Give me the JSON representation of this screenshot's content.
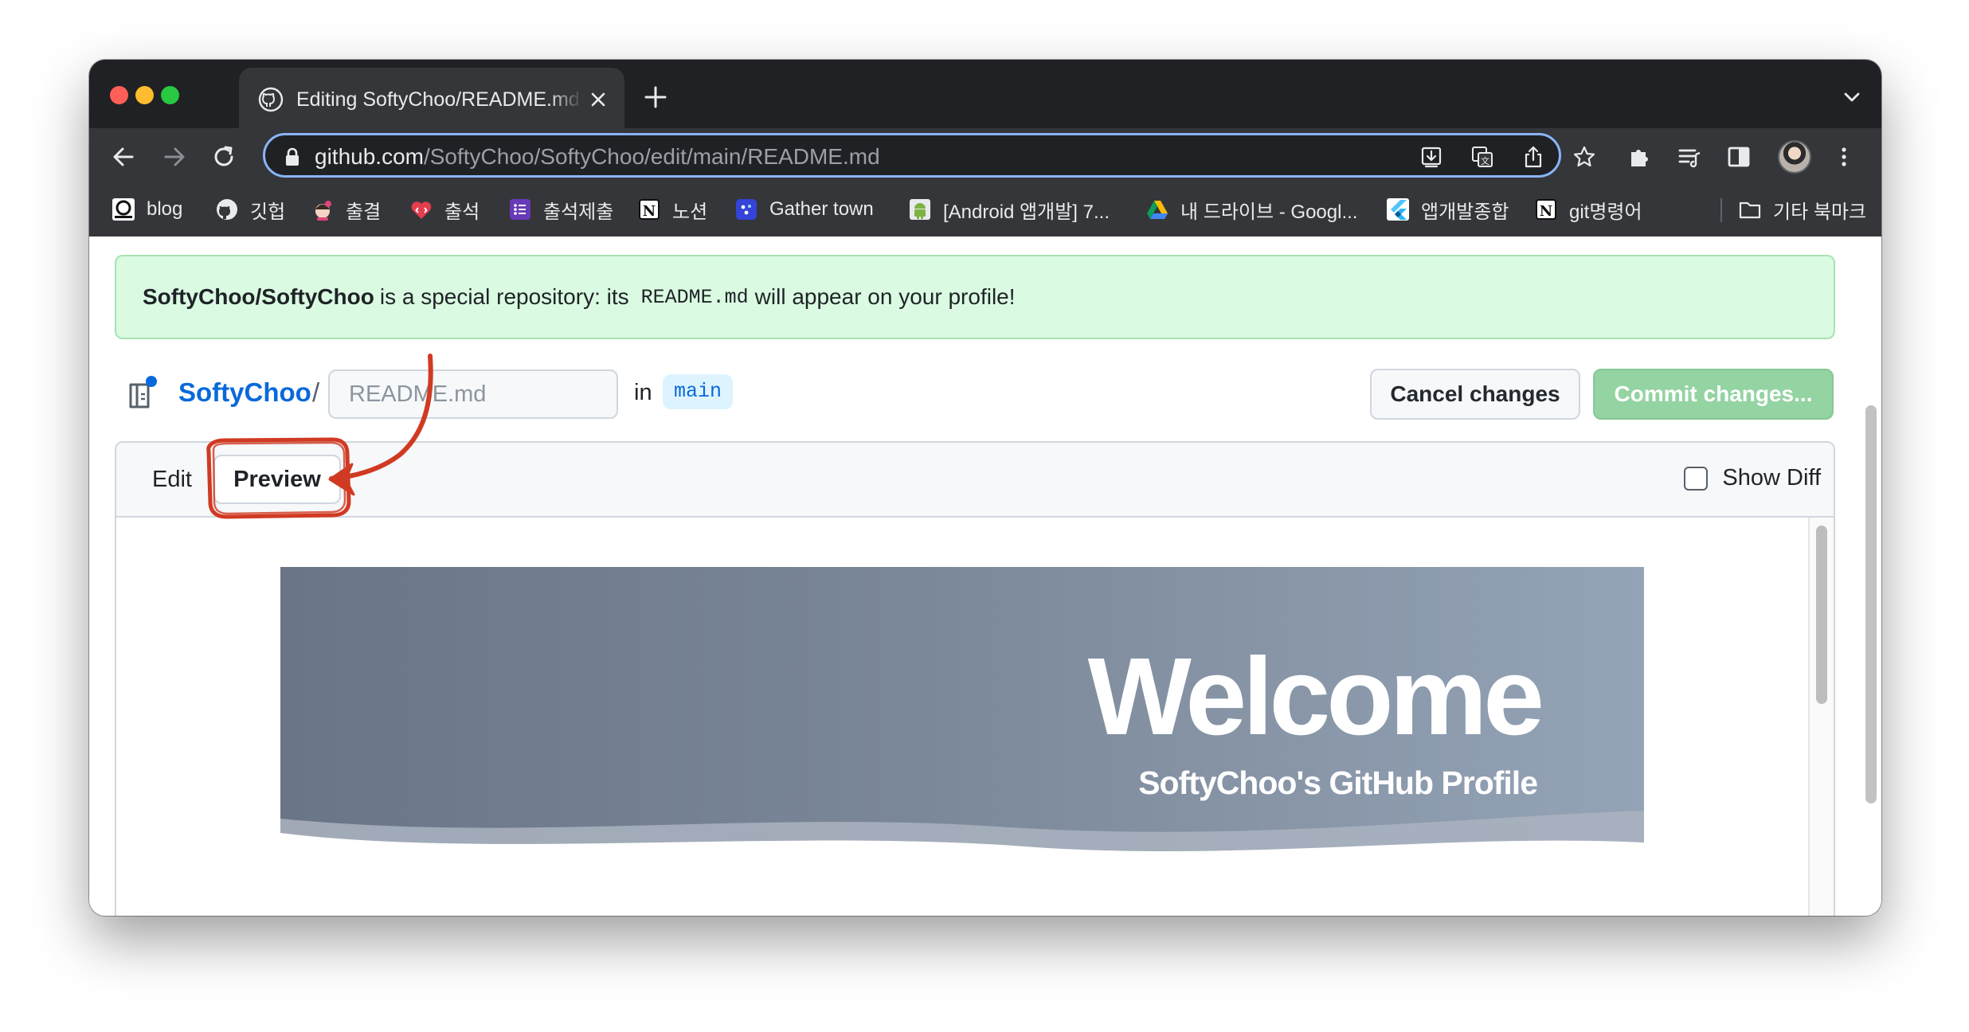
{
  "browser": {
    "tab_title": "Editing SoftyChoo/README.md",
    "url_host": "github.com",
    "url_path": "/SoftyChoo/SoftyChoo/edit/main/README.md",
    "bookmarks": [
      {
        "label": "blog",
        "icon": "blog-favicon-icon"
      },
      {
        "label": "깃헙",
        "icon": "github-favicon-icon"
      },
      {
        "label": "출결",
        "icon": "character-favicon-icon"
      },
      {
        "label": "출석",
        "icon": "heart-code-favicon-icon"
      },
      {
        "label": "출석제출",
        "icon": "form-list-favicon-icon"
      },
      {
        "label": "노션",
        "icon": "notion-favicon-icon"
      },
      {
        "label": "Gather town",
        "icon": "gather-favicon-icon"
      },
      {
        "label": "[Android 앱개발] 7...",
        "icon": "android-favicon-icon"
      },
      {
        "label": "내 드라이브 - Googl...",
        "icon": "google-drive-favicon-icon"
      },
      {
        "label": "앱개발종합",
        "icon": "flutter-favicon-icon"
      },
      {
        "label": "git명령어",
        "icon": "notion-favicon-icon"
      }
    ],
    "other_bookmarks": "기타 북마크"
  },
  "flash": {
    "repo": "SoftyChoo/SoftyChoo",
    "text_before": "is a special repository: its",
    "code": "README.md",
    "text_after": "will appear on your profile!"
  },
  "editor": {
    "repo_owner": "SoftyChoo",
    "separator": "/",
    "filename_placeholder": "README.md",
    "in_label": "in",
    "branch": "main",
    "cancel_label": "Cancel changes",
    "commit_label": "Commit changes...",
    "tab_edit": "Edit",
    "tab_preview": "Preview",
    "show_diff": "Show Diff"
  },
  "preview": {
    "banner_title": "Welcome",
    "banner_subtitle": "SoftyChoo's GitHub Profile"
  },
  "colors": {
    "chrome_dark": "#202124",
    "chrome_toolbar": "#35363a",
    "omnibox_focus": "#8ab4f8",
    "github_link": "#0969da",
    "flash_bg": "#dafbe1",
    "commit_disabled": "#94d3a2",
    "annotation_red": "#d13a22"
  }
}
